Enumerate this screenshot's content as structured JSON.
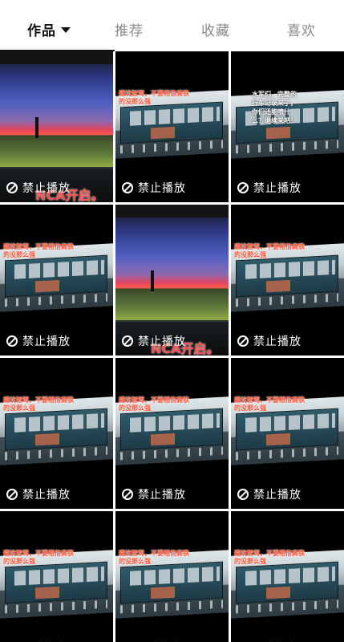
{
  "tabs": [
    {
      "label": "作品",
      "active": true
    },
    {
      "label": "推荐",
      "active": false
    },
    {
      "label": "收藏",
      "active": false
    },
    {
      "label": "喜欢",
      "active": false
    }
  ],
  "blocked_label": "禁止播放",
  "cells": [
    {
      "type": "sunset",
      "overlay": "NCA开启。"
    },
    {
      "type": "dash",
      "overlay": "避坑智驾，不要相信高铁的没那么强"
    },
    {
      "type": "dash-white",
      "overlay": "水军们，完整的行车记录来了，你们还能喷什么？继续来吧！"
    },
    {
      "type": "dash",
      "overlay": "避坑智驾，不要相信高铁的没那么强"
    },
    {
      "type": "sunset",
      "overlay": "NCA开启。"
    },
    {
      "type": "dash",
      "overlay": "避坑智驾，不要相信高铁的没那么强"
    },
    {
      "type": "dash",
      "overlay": "避坑智驾，不要相信高铁的没那么强"
    },
    {
      "type": "dash",
      "overlay": "避坑智驾，不要相信高铁的没那么强"
    },
    {
      "type": "dash",
      "overlay": "避坑智驾，不要相信高铁的没那么强"
    },
    {
      "type": "dash",
      "overlay": "避坑智驾，不要相信高铁的没那么强"
    },
    {
      "type": "dash",
      "overlay": "避坑智驾，不要相信高铁的没那么强"
    },
    {
      "type": "dash",
      "overlay": "避坑智驾，不要相信高铁的没那么强"
    }
  ],
  "colors": {
    "blocked_text": "#ffffff",
    "overlay_red": "#ff4d2e",
    "tab_active": "#111111",
    "tab_inactive": "#8a8a8a"
  },
  "icons": {
    "dropdown": "caret-down-icon",
    "blocked": "prohibited-icon"
  }
}
